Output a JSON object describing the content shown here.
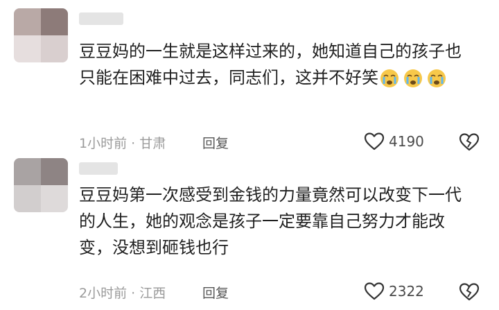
{
  "comments": [
    {
      "text": "豆豆妈的一生就是这样过来的，她知道自己的孩子也只能在困难中过去，同志们，这并不好笑",
      "time": "1小时前",
      "location": "甘肃",
      "reply_label": "回复",
      "likes": "4190",
      "emoji_icon": "crying-face-icon",
      "emoji_count": 3
    },
    {
      "text": "豆豆妈第一次感受到金钱的力量竟然可以改变下一代的人生，她的观念是孩子一定要靠自己努力才能改变，没想到砸钱也行",
      "time": "2小时前",
      "location": "江西",
      "reply_label": "回复",
      "likes": "2322"
    }
  ],
  "colors": {
    "text": "#1f1f1f",
    "meta": "#9a9a9a",
    "avatar_blur_1": [
      "#b9a9a6",
      "#8d7b79",
      "#e6dede",
      "#d9cfcf"
    ],
    "avatar_blur_2": [
      "#a9a3a3",
      "#8e8484",
      "#d2cece",
      "#dedada"
    ]
  }
}
